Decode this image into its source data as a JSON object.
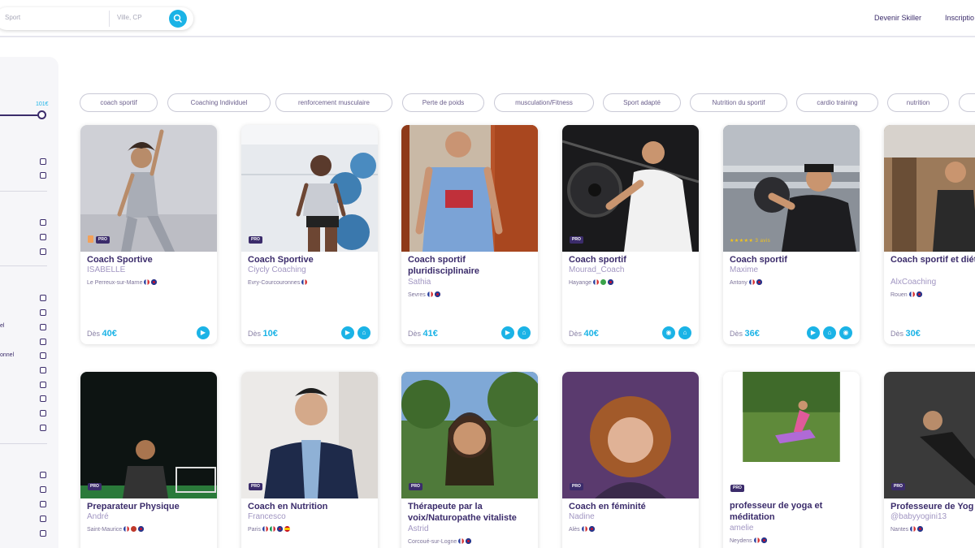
{
  "search": {
    "sport_placeholder": "Sport",
    "city_placeholder": "Ville, CP"
  },
  "header": {
    "become_skiller": "Devenir Skiller",
    "signup": "Inscriptio"
  },
  "sidebar": {
    "price_max": "101€",
    "fragments": [
      "el",
      "onnel"
    ]
  },
  "tags": [
    "coach sportif",
    "Coaching Individuel",
    "renforcement musculaire",
    "Perte de poids",
    "musculation/Fitness",
    "Sport adapté",
    "Nutrition du sportif",
    "cardio training",
    "nutrition",
    ""
  ],
  "badges": {
    "pro": "PRO",
    "stars": "★★★★★ 3 avis"
  },
  "colors": {
    "accent": "#1bb3e6",
    "primary": "#3b2c6b"
  },
  "cards": [
    {
      "title": "Coach Sportive",
      "name": "ISABELLE",
      "location": "Le Perreux-sur-Marne",
      "price_prefix": "Dès",
      "price": "40€"
    },
    {
      "title": "Coach Sportive",
      "name": "Ciycly Coaching",
      "location": "Evry-Courcouronnes",
      "price_prefix": "Dès",
      "price": "10€"
    },
    {
      "title": "Coach sportif pluridisciplinaire",
      "name": "Sathia",
      "location": "Sevres",
      "price_prefix": "Dès",
      "price": "41€"
    },
    {
      "title": "Coach sportif",
      "name": "Mourad_Coach",
      "location": "Hayange",
      "price_prefix": "Dès",
      "price": "40€"
    },
    {
      "title": "Coach sportif",
      "name": "Maxime",
      "location": "Antony",
      "price_prefix": "Dès",
      "price": "36€"
    },
    {
      "title": "Coach sportif et diét en ligne",
      "name": "AlxCoaching",
      "location": "Rouen",
      "price_prefix": "Dès",
      "price": "30€"
    },
    {
      "title": "Preparateur Physique",
      "name": "André",
      "location": "Saint-Maurice"
    },
    {
      "title": "Coach en Nutrition",
      "name": "Francesco",
      "location": "Paris"
    },
    {
      "title": "Thérapeute par la voix/Naturopathe vitaliste",
      "name": "Astrid",
      "location": "Corcoué-sur-Logne"
    },
    {
      "title": "Coach en féminité",
      "name": "Nadine",
      "location": "Alès"
    },
    {
      "title": "professeur de yoga et méditation",
      "name": "amelie",
      "location": "Neydens"
    },
    {
      "title": "Professeure de Yog",
      "name": "@babyyogini13",
      "location": "Nantes"
    }
  ]
}
